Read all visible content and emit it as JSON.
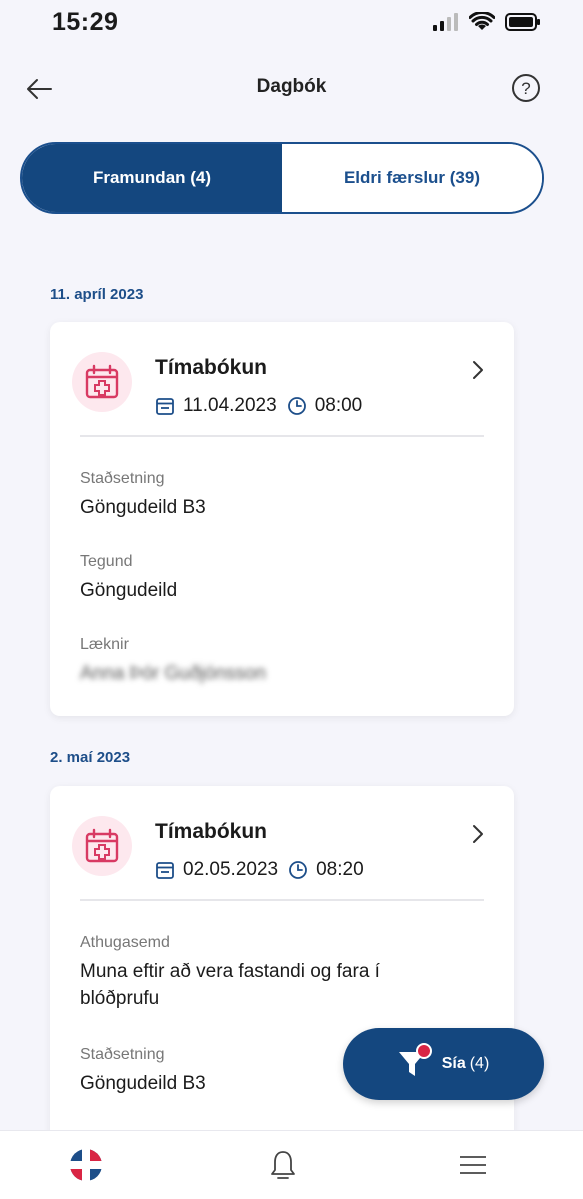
{
  "status_bar": {
    "time": "15:29"
  },
  "header": {
    "title": "Dagbók"
  },
  "tabs": [
    {
      "label": "Framundan (4)",
      "active": true
    },
    {
      "label": "Eldri færslur (39)",
      "active": false
    }
  ],
  "entries": [
    {
      "date_heading": "11. apríl 2023",
      "title": "Tímabókun",
      "date": "11.04.2023",
      "time": "08:00",
      "fields": [
        {
          "label": "Staðsetning",
          "value": "Göngudeild B3"
        },
        {
          "label": "Tegund",
          "value": "Göngudeild"
        },
        {
          "label": "Læknir",
          "value": "Anna Þór Guðjónsson",
          "redacted": true
        }
      ]
    },
    {
      "date_heading": "2. maí 2023",
      "title": "Tímabókun",
      "date": "02.05.2023",
      "time": "08:20",
      "fields": [
        {
          "label": "Athugasemd",
          "value": "Muna eftir að vera fastandi og fara í blóðprufu"
        },
        {
          "label": "Staðsetning",
          "value": "Göngudeild B3"
        }
      ]
    }
  ],
  "filter": {
    "label": "Sía",
    "count": "(4)"
  },
  "colors": {
    "primary": "#14477f",
    "accent": "#d92544",
    "icon_bg": "#fde8ee"
  },
  "bottom_nav": [
    {
      "icon": "home-logo-icon"
    },
    {
      "icon": "bell-icon"
    },
    {
      "icon": "menu-icon"
    }
  ]
}
